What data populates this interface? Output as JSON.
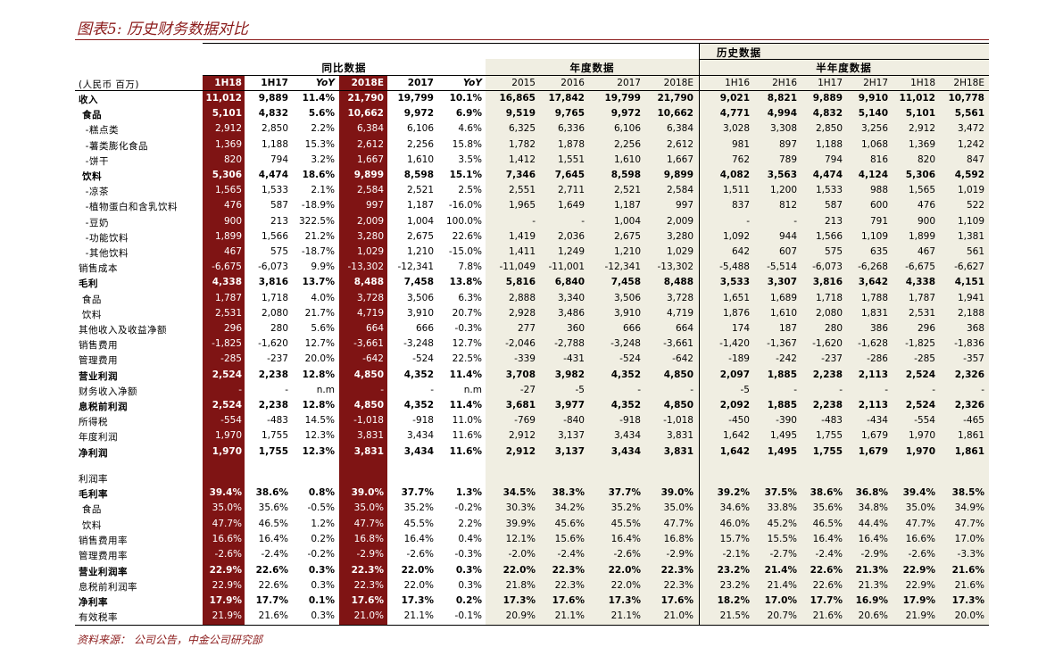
{
  "title": "图表5: 历史财务数据对比",
  "source": "资料来源： 公司公告，中金公司研究部",
  "groups": {
    "history": "历史数据",
    "yoy": "同比数据",
    "annual": "年度数据",
    "semi": "半年度数据"
  },
  "unit_label": "(人民币 百万)",
  "columns": [
    "1H18",
    "1H17",
    "YoY",
    "2018E",
    "2017",
    "YoY",
    "2015",
    "2016",
    "2017",
    "2018E",
    "1H16",
    "2H16",
    "1H17",
    "2H17",
    "1H18",
    "2H18E"
  ],
  "colors": {
    "accent": "#8b1a1a",
    "red_column": "#7f1414",
    "beige": "#f0eee2"
  },
  "rows": [
    {
      "label": "收入",
      "bold": true,
      "values": [
        "11,012",
        "9,889",
        "11.4%",
        "21,790",
        "19,799",
        "10.1%",
        "16,865",
        "17,842",
        "19,799",
        "21,790",
        "9,021",
        "8,821",
        "9,889",
        "9,910",
        "11,012",
        "10,778"
      ]
    },
    {
      "label": " 食品",
      "bold": true,
      "values": [
        "5,101",
        "4,832",
        "5.6%",
        "10,662",
        "9,972",
        "6.9%",
        "9,519",
        "9,765",
        "9,972",
        "10,662",
        "4,771",
        "4,994",
        "4,832",
        "5,140",
        "5,101",
        "5,561"
      ]
    },
    {
      "label": "  -糕点类",
      "bold": false,
      "values": [
        "2,912",
        "2,850",
        "2.2%",
        "6,384",
        "6,106",
        "4.6%",
        "6,325",
        "6,336",
        "6,106",
        "6,384",
        "3,028",
        "3,308",
        "2,850",
        "3,256",
        "2,912",
        "3,472"
      ]
    },
    {
      "label": "  -薯类膨化食品",
      "bold": false,
      "values": [
        "1,369",
        "1,188",
        "15.3%",
        "2,612",
        "2,256",
        "15.8%",
        "1,782",
        "1,878",
        "2,256",
        "2,612",
        "981",
        "897",
        "1,188",
        "1,068",
        "1,369",
        "1,242"
      ]
    },
    {
      "label": "  -饼干",
      "bold": false,
      "values": [
        "820",
        "794",
        "3.2%",
        "1,667",
        "1,610",
        "3.5%",
        "1,412",
        "1,551",
        "1,610",
        "1,667",
        "762",
        "789",
        "794",
        "816",
        "820",
        "847"
      ]
    },
    {
      "label": " 饮料",
      "bold": true,
      "values": [
        "5,306",
        "4,474",
        "18.6%",
        "9,899",
        "8,598",
        "15.1%",
        "7,346",
        "7,645",
        "8,598",
        "9,899",
        "4,082",
        "3,563",
        "4,474",
        "4,124",
        "5,306",
        "4,592"
      ]
    },
    {
      "label": "  -凉茶",
      "bold": false,
      "values": [
        "1,565",
        "1,533",
        "2.1%",
        "2,584",
        "2,521",
        "2.5%",
        "2,551",
        "2,711",
        "2,521",
        "2,584",
        "1,511",
        "1,200",
        "1,533",
        "988",
        "1,565",
        "1,019"
      ]
    },
    {
      "label": "  -植物蛋白和含乳饮料",
      "bold": false,
      "values": [
        "476",
        "587",
        "-18.9%",
        "997",
        "1,187",
        "-16.0%",
        "1,965",
        "1,649",
        "1,187",
        "997",
        "837",
        "812",
        "587",
        "600",
        "476",
        "522"
      ]
    },
    {
      "label": "  -豆奶",
      "bold": false,
      "values": [
        "900",
        "213",
        "322.5%",
        "2,009",
        "1,004",
        "100.0%",
        "-",
        "-",
        "1,004",
        "2,009",
        "-",
        "-",
        "213",
        "791",
        "900",
        "1,109"
      ]
    },
    {
      "label": "  -功能饮料",
      "bold": false,
      "values": [
        "1,899",
        "1,566",
        "21.2%",
        "3,280",
        "2,675",
        "22.6%",
        "1,419",
        "2,036",
        "2,675",
        "3,280",
        "1,092",
        "944",
        "1,566",
        "1,109",
        "1,899",
        "1,381"
      ]
    },
    {
      "label": "  -其他饮料",
      "bold": false,
      "values": [
        "467",
        "575",
        "-18.7%",
        "1,029",
        "1,210",
        "-15.0%",
        "1,411",
        "1,249",
        "1,210",
        "1,029",
        "642",
        "607",
        "575",
        "635",
        "467",
        "561"
      ]
    },
    {
      "label": "销售成本",
      "bold": false,
      "values": [
        "-6,675",
        "-6,073",
        "9.9%",
        "-13,302",
        "-12,341",
        "7.8%",
        "-11,049",
        "-11,001",
        "-12,341",
        "-13,302",
        "-5,488",
        "-5,514",
        "-6,073",
        "-6,268",
        "-6,675",
        "-6,627"
      ]
    },
    {
      "label": "毛利",
      "bold": true,
      "values": [
        "4,338",
        "3,816",
        "13.7%",
        "8,488",
        "7,458",
        "13.8%",
        "5,816",
        "6,840",
        "7,458",
        "8,488",
        "3,533",
        "3,307",
        "3,816",
        "3,642",
        "4,338",
        "4,151"
      ]
    },
    {
      "label": " 食品",
      "bold": false,
      "values": [
        "1,787",
        "1,718",
        "4.0%",
        "3,728",
        "3,506",
        "6.3%",
        "2,888",
        "3,340",
        "3,506",
        "3,728",
        "1,651",
        "1,689",
        "1,718",
        "1,788",
        "1,787",
        "1,941"
      ]
    },
    {
      "label": " 饮料",
      "bold": false,
      "values": [
        "2,531",
        "2,080",
        "21.7%",
        "4,719",
        "3,910",
        "20.7%",
        "2,928",
        "3,486",
        "3,910",
        "4,719",
        "1,876",
        "1,610",
        "2,080",
        "1,831",
        "2,531",
        "2,188"
      ]
    },
    {
      "label": "其他收入及收益净额",
      "bold": false,
      "values": [
        "296",
        "280",
        "5.6%",
        "664",
        "666",
        "-0.3%",
        "277",
        "360",
        "666",
        "664",
        "174",
        "187",
        "280",
        "386",
        "296",
        "368"
      ]
    },
    {
      "label": "销售费用",
      "bold": false,
      "values": [
        "-1,825",
        "-1,620",
        "12.7%",
        "-3,661",
        "-3,248",
        "12.7%",
        "-2,046",
        "-2,788",
        "-3,248",
        "-3,661",
        "-1,420",
        "-1,367",
        "-1,620",
        "-1,628",
        "-1,825",
        "-1,836"
      ]
    },
    {
      "label": "管理费用",
      "bold": false,
      "values": [
        "-285",
        "-237",
        "20.0%",
        "-642",
        "-524",
        "22.5%",
        "-339",
        "-431",
        "-524",
        "-642",
        "-189",
        "-242",
        "-237",
        "-286",
        "-285",
        "-357"
      ]
    },
    {
      "label": "营业利润",
      "bold": true,
      "values": [
        "2,524",
        "2,238",
        "12.8%",
        "4,850",
        "4,352",
        "11.4%",
        "3,708",
        "3,982",
        "4,352",
        "4,850",
        "2,097",
        "1,885",
        "2,238",
        "2,113",
        "2,524",
        "2,326"
      ]
    },
    {
      "label": "财务收入净额",
      "bold": false,
      "values": [
        "-",
        "-",
        "n.m",
        "-",
        "-",
        "n.m",
        "-27",
        "-5",
        "-",
        "-",
        "-5",
        "-",
        "-",
        "-",
        "-",
        "-"
      ]
    },
    {
      "label": "息税前利润",
      "bold": true,
      "values": [
        "2,524",
        "2,238",
        "12.8%",
        "4,850",
        "4,352",
        "11.4%",
        "3,681",
        "3,977",
        "4,352",
        "4,850",
        "2,092",
        "1,885",
        "2,238",
        "2,113",
        "2,524",
        "2,326"
      ]
    },
    {
      "label": "所得税",
      "bold": false,
      "values": [
        "-554",
        "-483",
        "14.5%",
        "-1,018",
        "-918",
        "11.0%",
        "-769",
        "-840",
        "-918",
        "-1,018",
        "-450",
        "-390",
        "-483",
        "-434",
        "-554",
        "-465"
      ]
    },
    {
      "label": "年度利润",
      "bold": false,
      "values": [
        "1,970",
        "1,755",
        "12.3%",
        "3,831",
        "3,434",
        "11.6%",
        "2,912",
        "3,137",
        "3,434",
        "3,831",
        "1,642",
        "1,495",
        "1,755",
        "1,679",
        "1,970",
        "1,861"
      ]
    },
    {
      "label": "净利润",
      "bold": true,
      "values": [
        "1,970",
        "1,755",
        "12.3%",
        "3,831",
        "3,434",
        "11.6%",
        "2,912",
        "3,137",
        "3,434",
        "3,831",
        "1,642",
        "1,495",
        "1,755",
        "1,679",
        "1,970",
        "1,861"
      ]
    },
    {
      "label": "利润率",
      "bold": false,
      "values": null
    },
    {
      "label": "毛利率",
      "bold": true,
      "values": [
        "39.4%",
        "38.6%",
        "0.8%",
        "39.0%",
        "37.7%",
        "1.3%",
        "34.5%",
        "38.3%",
        "37.7%",
        "39.0%",
        "39.2%",
        "37.5%",
        "38.6%",
        "36.8%",
        "39.4%",
        "38.5%"
      ]
    },
    {
      "label": " 食品",
      "bold": false,
      "values": [
        "35.0%",
        "35.6%",
        "-0.5%",
        "35.0%",
        "35.2%",
        "-0.2%",
        "30.3%",
        "34.2%",
        "35.2%",
        "35.0%",
        "34.6%",
        "33.8%",
        "35.6%",
        "34.8%",
        "35.0%",
        "34.9%"
      ]
    },
    {
      "label": " 饮料",
      "bold": false,
      "values": [
        "47.7%",
        "46.5%",
        "1.2%",
        "47.7%",
        "45.5%",
        "2.2%",
        "39.9%",
        "45.6%",
        "45.5%",
        "47.7%",
        "46.0%",
        "45.2%",
        "46.5%",
        "44.4%",
        "47.7%",
        "47.7%"
      ]
    },
    {
      "label": "销售费用率",
      "bold": false,
      "values": [
        "16.6%",
        "16.4%",
        "0.2%",
        "16.8%",
        "16.4%",
        "0.4%",
        "12.1%",
        "15.6%",
        "16.4%",
        "16.8%",
        "15.7%",
        "15.5%",
        "16.4%",
        "16.4%",
        "16.6%",
        "17.0%"
      ]
    },
    {
      "label": "管理费用率",
      "bold": false,
      "values": [
        "-2.6%",
        "-2.4%",
        "-0.2%",
        "-2.9%",
        "-2.6%",
        "-0.3%",
        "-2.0%",
        "-2.4%",
        "-2.6%",
        "-2.9%",
        "-2.1%",
        "-2.7%",
        "-2.4%",
        "-2.9%",
        "-2.6%",
        "-3.3%"
      ]
    },
    {
      "label": "营业利润率",
      "bold": true,
      "values": [
        "22.9%",
        "22.6%",
        "0.3%",
        "22.3%",
        "22.0%",
        "0.3%",
        "22.0%",
        "22.3%",
        "22.0%",
        "22.3%",
        "23.2%",
        "21.4%",
        "22.6%",
        "21.3%",
        "22.9%",
        "21.6%"
      ]
    },
    {
      "label": "息税前利润率",
      "bold": false,
      "values": [
        "22.9%",
        "22.6%",
        "0.3%",
        "22.3%",
        "22.0%",
        "0.3%",
        "21.8%",
        "22.3%",
        "22.0%",
        "22.3%",
        "23.2%",
        "21.4%",
        "22.6%",
        "21.3%",
        "22.9%",
        "21.6%"
      ]
    },
    {
      "label": "净利率",
      "bold": true,
      "values": [
        "17.9%",
        "17.7%",
        "0.1%",
        "17.6%",
        "17.3%",
        "0.2%",
        "17.3%",
        "17.6%",
        "17.3%",
        "17.6%",
        "18.2%",
        "17.0%",
        "17.7%",
        "16.9%",
        "17.9%",
        "17.3%"
      ]
    },
    {
      "label": "有效税率",
      "bold": false,
      "values": [
        "21.9%",
        "21.6%",
        "0.3%",
        "21.0%",
        "21.1%",
        "-0.1%",
        "20.9%",
        "21.1%",
        "21.1%",
        "21.0%",
        "21.5%",
        "20.7%",
        "21.6%",
        "20.6%",
        "21.9%",
        "20.0%"
      ]
    }
  ]
}
